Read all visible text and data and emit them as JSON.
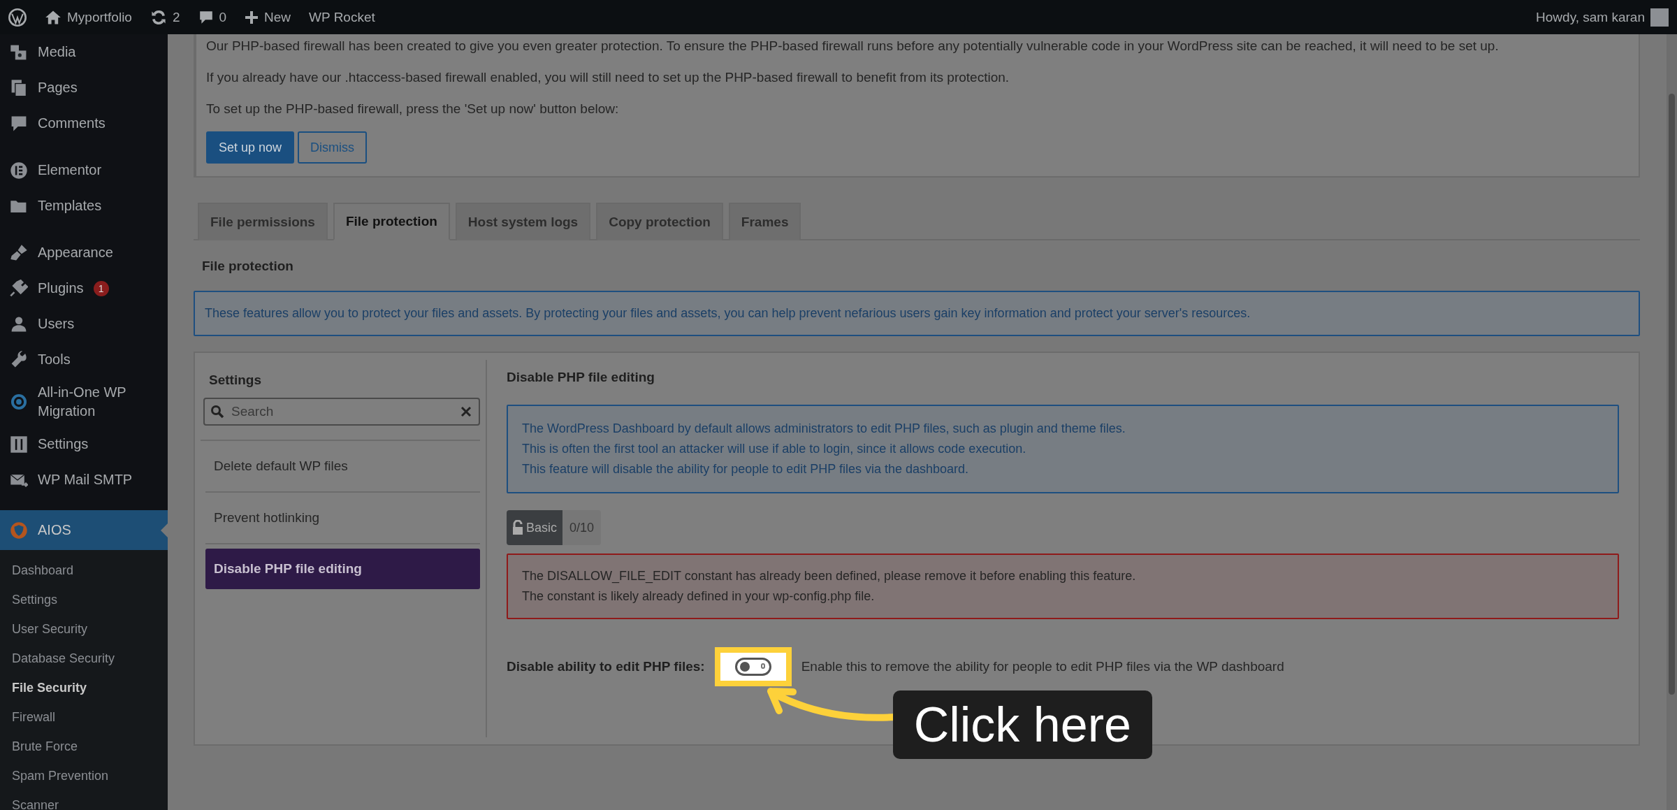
{
  "admin_bar": {
    "site": "Myportfolio",
    "updates": "2",
    "comments": "0",
    "new": "New",
    "plugin": "WP Rocket",
    "greeting": "Howdy, sam karan"
  },
  "sidebar": {
    "items": [
      {
        "label": "Media",
        "selected": false
      },
      {
        "label": "Pages",
        "selected": false
      },
      {
        "label": "Comments",
        "selected": false
      },
      {
        "label": "Elementor",
        "selected": false
      },
      {
        "label": "Templates",
        "selected": false
      },
      {
        "label": "Appearance",
        "selected": false
      },
      {
        "label": "Plugins",
        "badge": "1",
        "selected": false
      },
      {
        "label": "Users",
        "selected": false
      },
      {
        "label": "Tools",
        "selected": false
      },
      {
        "label": "All-in-One WP Migration",
        "selected": false
      },
      {
        "label": "Settings",
        "selected": false
      },
      {
        "label": "WP Mail SMTP",
        "selected": false
      },
      {
        "label": "AIOS",
        "selected": true
      }
    ],
    "submenu": [
      {
        "label": "Dashboard",
        "selected": false
      },
      {
        "label": "Settings",
        "selected": false
      },
      {
        "label": "User Security",
        "selected": false
      },
      {
        "label": "Database Security",
        "selected": false
      },
      {
        "label": "File Security",
        "selected": true
      },
      {
        "label": "Firewall",
        "selected": false
      },
      {
        "label": "Brute Force",
        "selected": false
      },
      {
        "label": "Spam Prevention",
        "selected": false
      },
      {
        "label": "Scanner",
        "selected": false
      }
    ]
  },
  "notice": {
    "paragraphs": [
      "Our PHP-based firewall has been created to give you even greater protection. To ensure the PHP-based firewall runs before any potentially vulnerable code in your WordPress site can be reached, it will need to be set up.",
      "If you already have our .htaccess-based firewall enabled, you will still need to set up the PHP-based firewall to benefit from its protection.",
      "To set up the PHP-based firewall, press the 'Set up now' button below:"
    ],
    "buttons": [
      {
        "label": "Set up now",
        "kind": "primary"
      },
      {
        "label": "Dismiss",
        "kind": "secondary"
      }
    ]
  },
  "tabs": [
    {
      "label": "File permissions",
      "selected": false
    },
    {
      "label": "File protection",
      "selected": true
    },
    {
      "label": "Host system logs",
      "selected": false
    },
    {
      "label": "Copy protection",
      "selected": false
    },
    {
      "label": "Frames",
      "selected": false
    }
  ],
  "section_title": "File protection",
  "section_info": "These features allow you to protect your files and assets. By protecting your files and assets, you can help prevent nefarious users gain key information and protect your server's resources.",
  "settings": {
    "title": "Settings",
    "search": {
      "placeholder": "Search"
    },
    "items": [
      {
        "label": "Delete default WP files",
        "selected": false
      },
      {
        "label": "Prevent hotlinking",
        "selected": false
      },
      {
        "label": "Disable PHP file editing",
        "selected": true
      }
    ]
  },
  "file_editing": {
    "title": "Disable PHP file editing",
    "info_lines": [
      "The WordPress Dashboard by default allows administrators to edit PHP files, such as plugin and theme files.",
      "This is often the first tool an attacker will use if able to login, since it allows code execution.",
      "This feature will disable the ability for people to edit PHP files via the dashboard."
    ],
    "badge": {
      "label": "Basic",
      "score": "0/10"
    },
    "error_lines": [
      "The DISALLOW_FILE_EDIT constant has already been defined, please remove it before enabling this feature.",
      "The constant is likely already defined in your wp-config.php file."
    ],
    "toggle": {
      "label": "Disable ability to edit PHP files:",
      "on": false,
      "description": "Enable this to remove the ability for people to edit PHP files via the WP dashboard"
    }
  },
  "callout": {
    "text": "Click here"
  }
}
